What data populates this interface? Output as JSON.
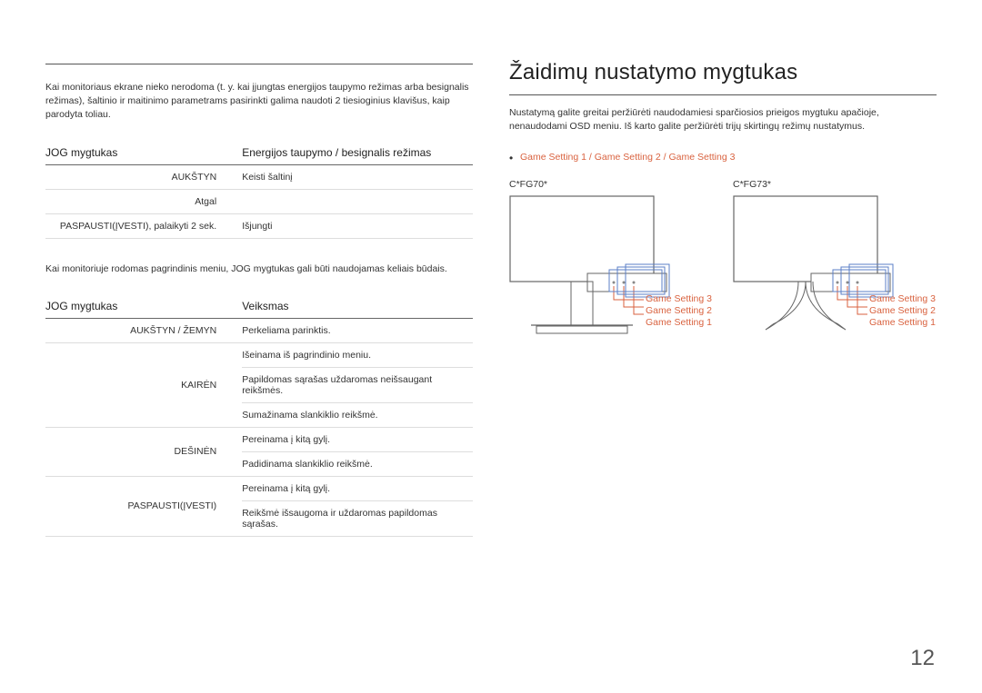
{
  "left": {
    "intro1": "Kai monitoriaus ekrane nieko nerodoma (t. y. kai įjungtas energijos taupymo režimas arba besignalis režimas), šaltinio ir maitinimo parametrams pasirinkti galima naudoti 2 tiesioginius klavišus, kaip parodyta toliau.",
    "table1": {
      "head1": "JOG mygtukas",
      "head2": "Energijos taupymo / besignalis režimas",
      "rows": [
        {
          "label": "AUKŠTYN",
          "val": "Keisti šaltinį"
        },
        {
          "label": "Atgal",
          "val": ""
        },
        {
          "label": "PASPAUSTI(ĮVESTI), palaikyti 2 sek.",
          "val": "Išjungti"
        }
      ]
    },
    "intro2": "Kai monitoriuje rodomas pagrindinis meniu, JOG mygtukas gali būti naudojamas keliais būdais.",
    "table2": {
      "head1": "JOG mygtukas",
      "head2": "Veiksmas",
      "rows": [
        {
          "label": "AUKŠTYN / ŽEMYN",
          "val": "Perkeliama parinktis."
        },
        {
          "label": "",
          "val": "Išeinama iš pagrindinio meniu."
        },
        {
          "label": "KAIRĖN",
          "val": "Papildomas sąrašas uždaromas neišsaugant reikšmės."
        },
        {
          "label": "",
          "val": "Sumažinama slankiklio reikšmė."
        },
        {
          "label": "DEŠINĖN",
          "val": "Pereinama į kitą gylį."
        },
        {
          "label": "",
          "val": "Padidinama slankiklio reikšmė."
        },
        {
          "label": "PASPAUSTI(ĮVESTI)",
          "val": "Pereinama į kitą gylį."
        },
        {
          "label": "",
          "val": "Reikšmė išsaugoma ir uždaromas papildomas sąrašas."
        }
      ]
    }
  },
  "right": {
    "title": "Žaidimų nustatymo mygtukas",
    "para": "Nustatymą galite greitai peržiūrėti naudodamiesi sparčiosios prieigos mygtuku apačioje, nenaudodami OSD meniu. Iš karto galite peržiūrėti trijų skirtingų režimų nustatymus.",
    "bullet_prefix": "",
    "settings": [
      "Game Setting 1",
      "Game Setting 2",
      "Game Setting 3"
    ],
    "sep": " / ",
    "model1": "C*FG70*",
    "model2": "C*FG73*",
    "legend1": "Game Setting 3",
    "legend2": "Game Setting 2",
    "legend3": "Game Setting 1"
  },
  "page_number": "12"
}
